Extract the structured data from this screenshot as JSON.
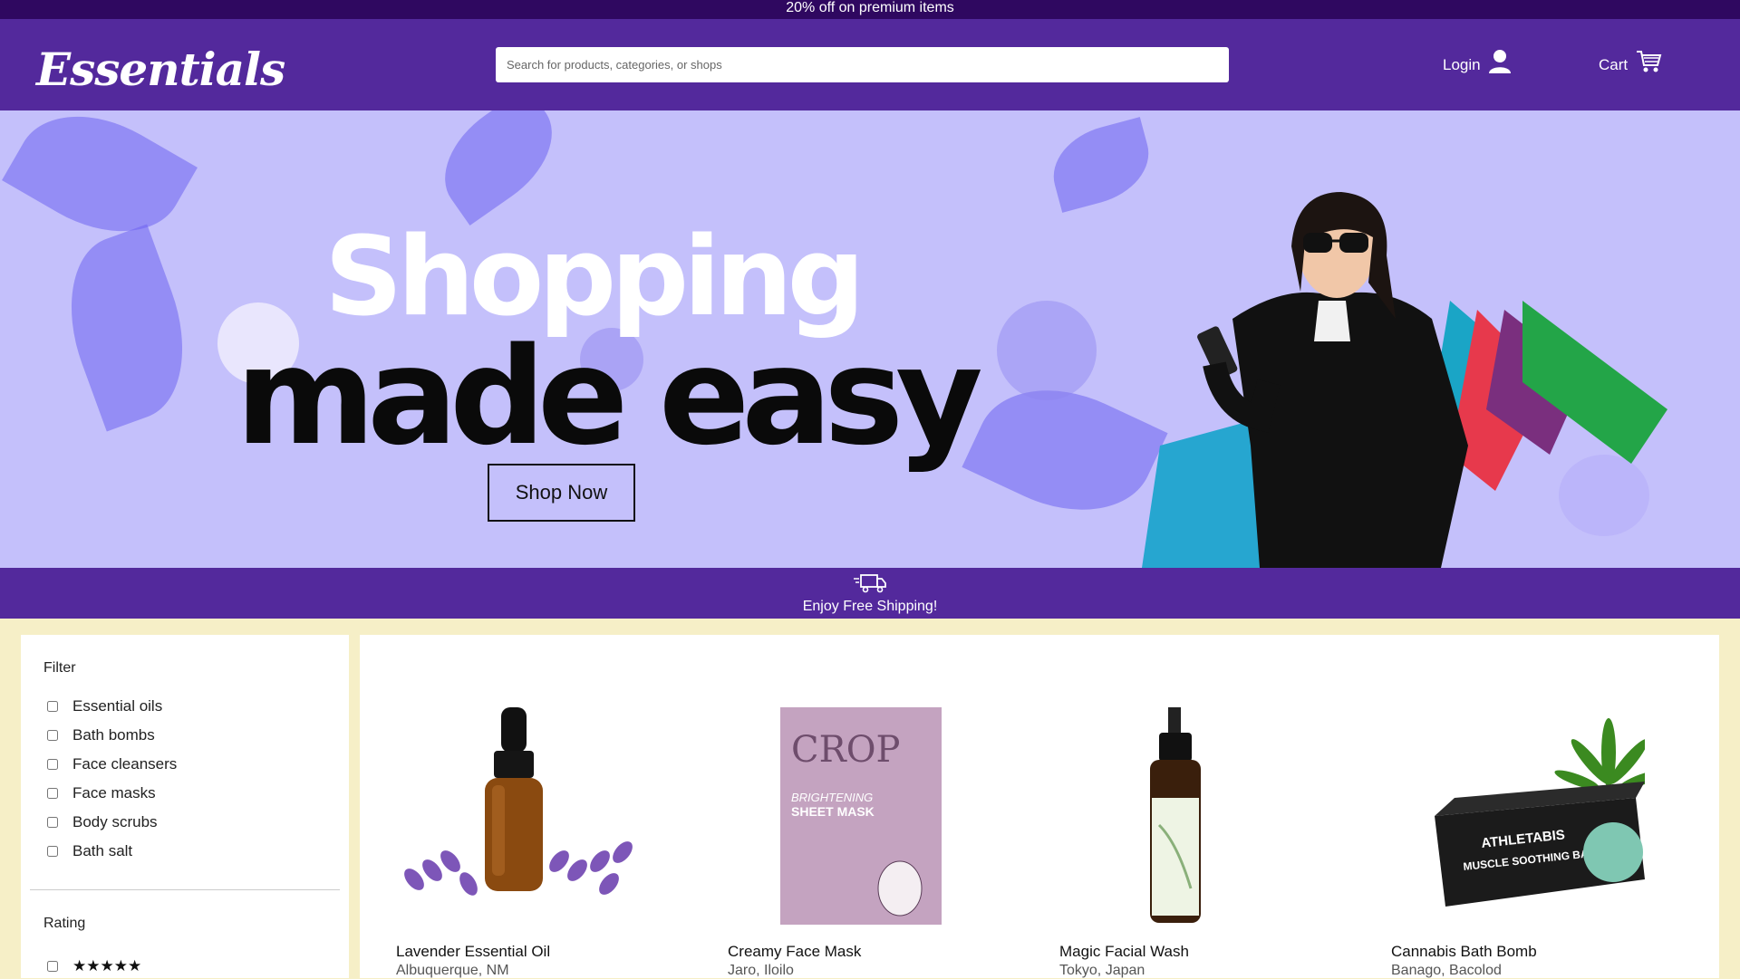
{
  "promo": {
    "text": "20% off on premium items"
  },
  "header": {
    "logo": "Essentials",
    "search_placeholder": "Search for products, categories, or shops",
    "login_label": "Login",
    "cart_label": "Cart"
  },
  "hero": {
    "line1": "Shopping",
    "line2": "made easy",
    "cta": "Shop Now"
  },
  "shipping": {
    "text": "Enjoy Free Shipping!"
  },
  "filter": {
    "title": "Filter",
    "options": [
      "Essential oils",
      "Bath bombs",
      "Face cleansers",
      "Face masks",
      "Body scrubs",
      "Bath salt"
    ],
    "rating_title": "Rating",
    "rating_stars": "★★★★★"
  },
  "products": [
    {
      "name": "Lavender Essential Oil",
      "location": "Albuquerque, NM"
    },
    {
      "name": "Creamy Face Mask",
      "location": "Jaro, Iloilo"
    },
    {
      "name": "Magic Facial Wash",
      "location": "Tokyo, Japan"
    },
    {
      "name": "Cannabis Bath Bomb",
      "location": "Banago, Bacolod"
    }
  ],
  "product_art": {
    "mask_brand": "CROP",
    "mask_line1": "BRIGHTENING",
    "mask_line2": "SHEET MASK",
    "bathbomb_brand": "ATHLETABIS",
    "bathbomb_line": "MUSCLE SOOTHING BATH"
  },
  "colors": {
    "promo_bg": "#2f0860",
    "header_bg": "#53299c",
    "hero_bg": "#c4c0fb",
    "page_bg": "#f6efc7"
  }
}
